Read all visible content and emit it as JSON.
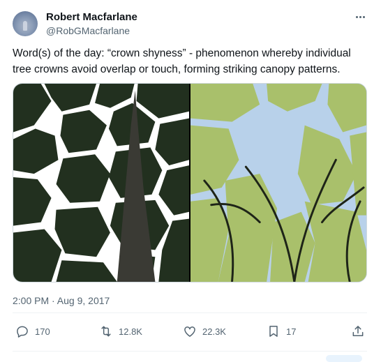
{
  "author": {
    "name": "Robert Macfarlane",
    "handle": "@RobGMacfarlane"
  },
  "tweet": {
    "text": "Word(s) of the day: “crown shyness” - phenomenon whereby individual tree crowns avoid overlap or touch, forming striking canopy patterns.",
    "timestamp": "2:00 PM · Aug 9, 2017"
  },
  "media": {
    "images": [
      {
        "name": "crown-shyness-dark-canopy-photo"
      },
      {
        "name": "crown-shyness-green-canopy-photo"
      }
    ]
  },
  "actions": {
    "reply": {
      "icon": "reply-icon",
      "count": "170"
    },
    "retweet": {
      "icon": "retweet-icon",
      "count": "12.8K"
    },
    "like": {
      "icon": "heart-icon",
      "count": "22.3K"
    },
    "bookmark": {
      "icon": "bookmark-icon",
      "count": "17"
    },
    "share": {
      "icon": "share-icon"
    }
  },
  "colors": {
    "text_primary": "#0f1419",
    "text_secondary": "#536471",
    "border": "#cfd9de"
  }
}
